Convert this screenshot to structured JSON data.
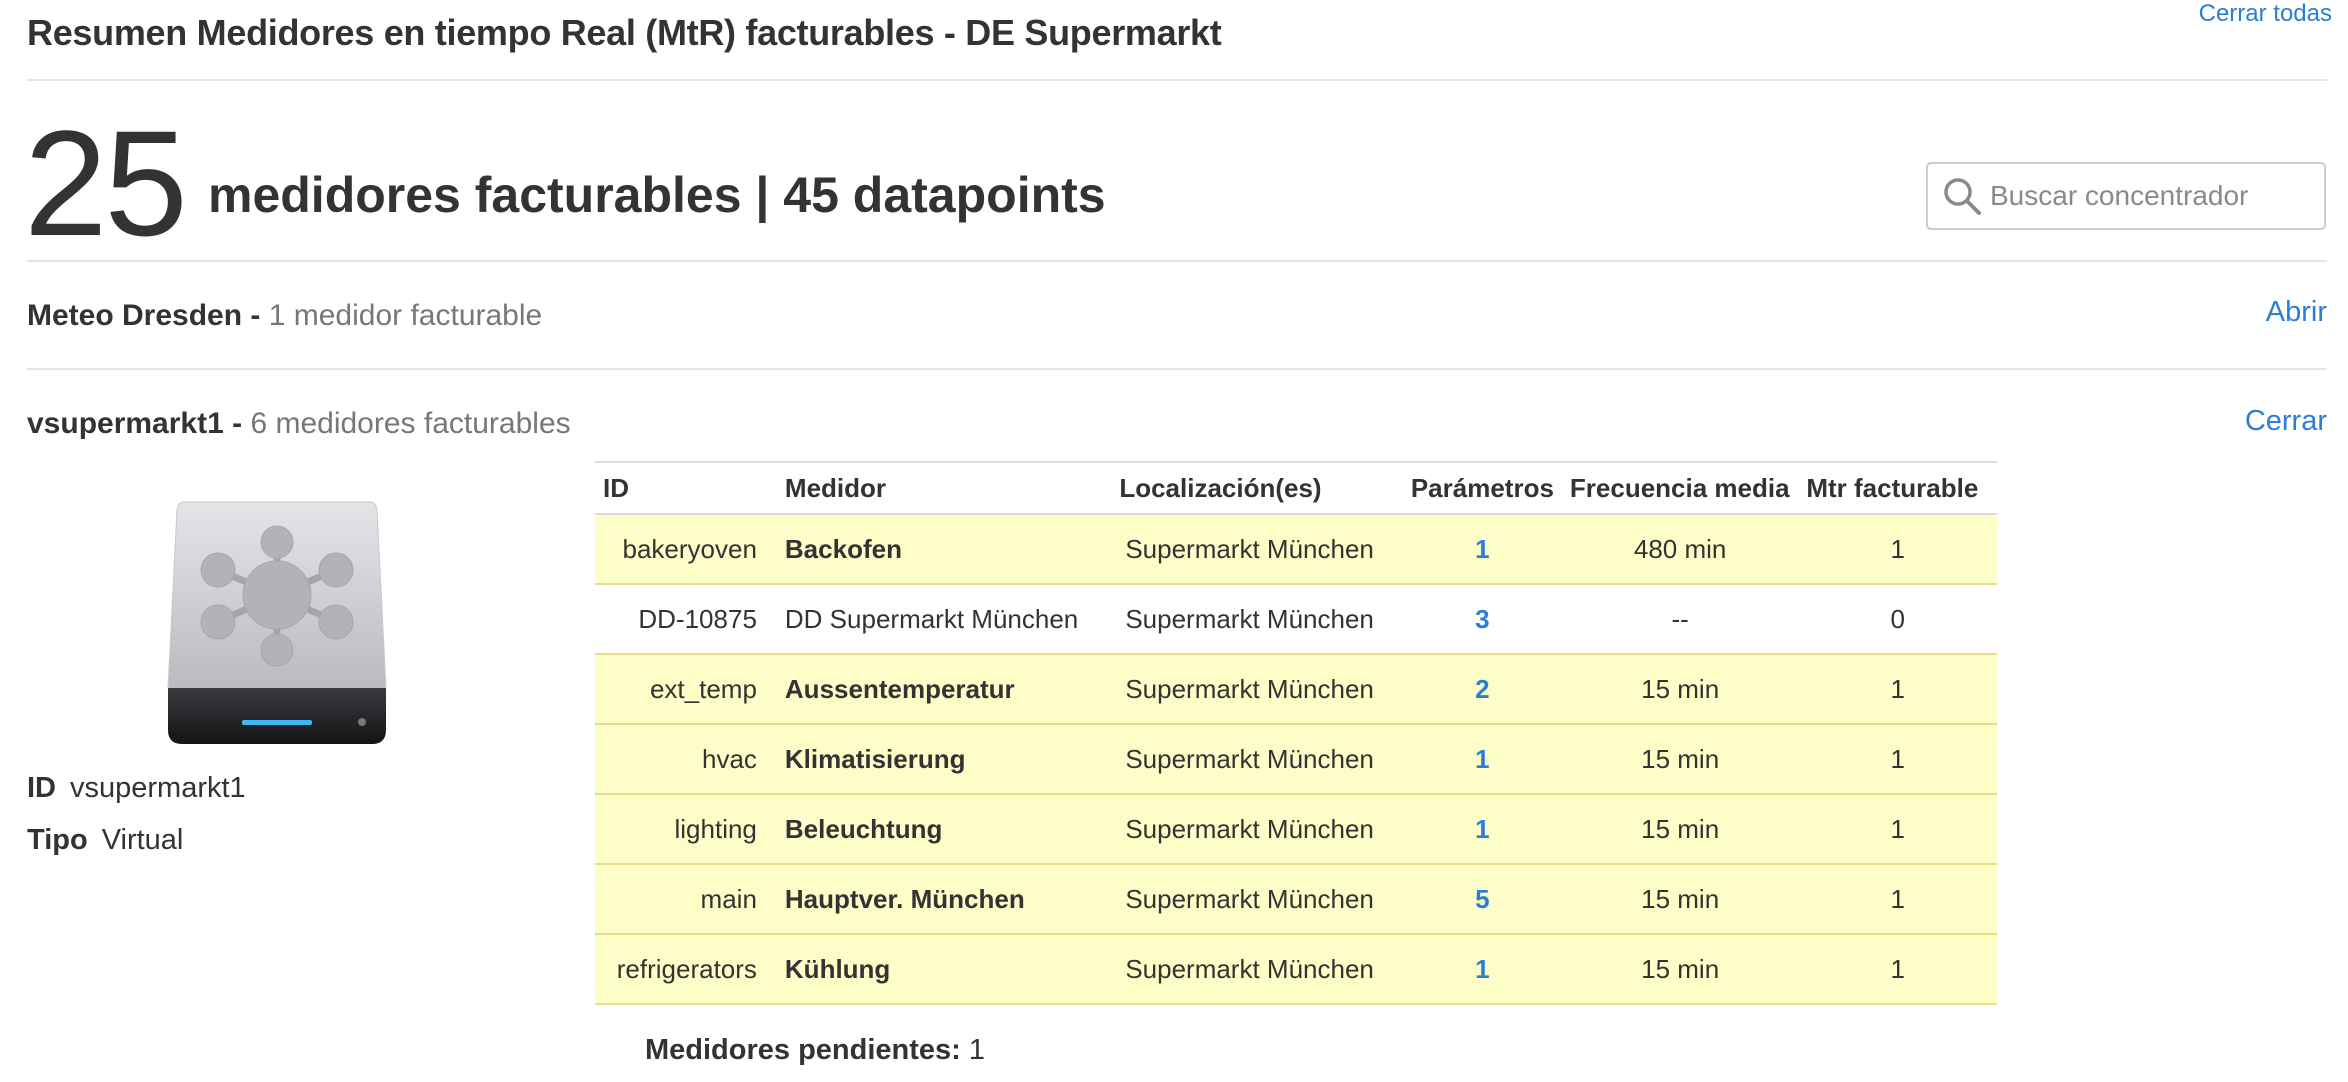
{
  "page": {
    "title": "Resumen Medidores en tiempo Real (MtR) facturables - DE Supermarkt",
    "close_all": "Cerrar todas"
  },
  "summary": {
    "count": "25",
    "text": "medidores facturables | 45 datapoints"
  },
  "search": {
    "placeholder": "Buscar concentrador",
    "value": ""
  },
  "groups": [
    {
      "name": "Meteo Dresden -",
      "subtitle": "1 medidor facturable",
      "action": "Abrir"
    },
    {
      "name": "vsupermarkt1 -",
      "subtitle": "6 medidores facturables",
      "action": "Cerrar",
      "device": {
        "icon": "server-drive-icon",
        "id_label": "ID",
        "id_value": "vsupermarkt1",
        "type_label": "Tipo",
        "type_value": "Virtual"
      },
      "table": {
        "columns": [
          "ID",
          "Medidor",
          "Localización(es)",
          "Parámetros",
          "Frecuencia media",
          "Mtr facturable"
        ],
        "rows": [
          {
            "id": "bakeryoven",
            "name": "Backofen",
            "location": "Supermarkt München",
            "params": "1",
            "freq": "480 min",
            "mtr": "1",
            "billable": true
          },
          {
            "id": "DD-10875",
            "name": "DD Supermarkt München",
            "location": "Supermarkt München",
            "params": "3",
            "freq": "--",
            "mtr": "0",
            "billable": false
          },
          {
            "id": "ext_temp",
            "name": "Aussentemperatur",
            "location": "Supermarkt München",
            "params": "2",
            "freq": "15 min",
            "mtr": "1",
            "billable": true
          },
          {
            "id": "hvac",
            "name": "Klimatisierung",
            "location": "Supermarkt München",
            "params": "1",
            "freq": "15 min",
            "mtr": "1",
            "billable": true
          },
          {
            "id": "lighting",
            "name": "Beleuchtung",
            "location": "Supermarkt München",
            "params": "1",
            "freq": "15 min",
            "mtr": "1",
            "billable": true
          },
          {
            "id": "main",
            "name": "Hauptver. München",
            "location": "Supermarkt München",
            "params": "5",
            "freq": "15 min",
            "mtr": "1",
            "billable": true
          },
          {
            "id": "refrigerators",
            "name": "Kühlung",
            "location": "Supermarkt München",
            "params": "1",
            "freq": "15 min",
            "mtr": "1",
            "billable": true
          }
        ]
      },
      "pending_label": "Medidores pendientes:",
      "pending_value": "1"
    }
  ],
  "colors": {
    "link": "#2a7fd4",
    "highlight_row": "#fdfdc8",
    "row_border": "#e8dc8c"
  }
}
